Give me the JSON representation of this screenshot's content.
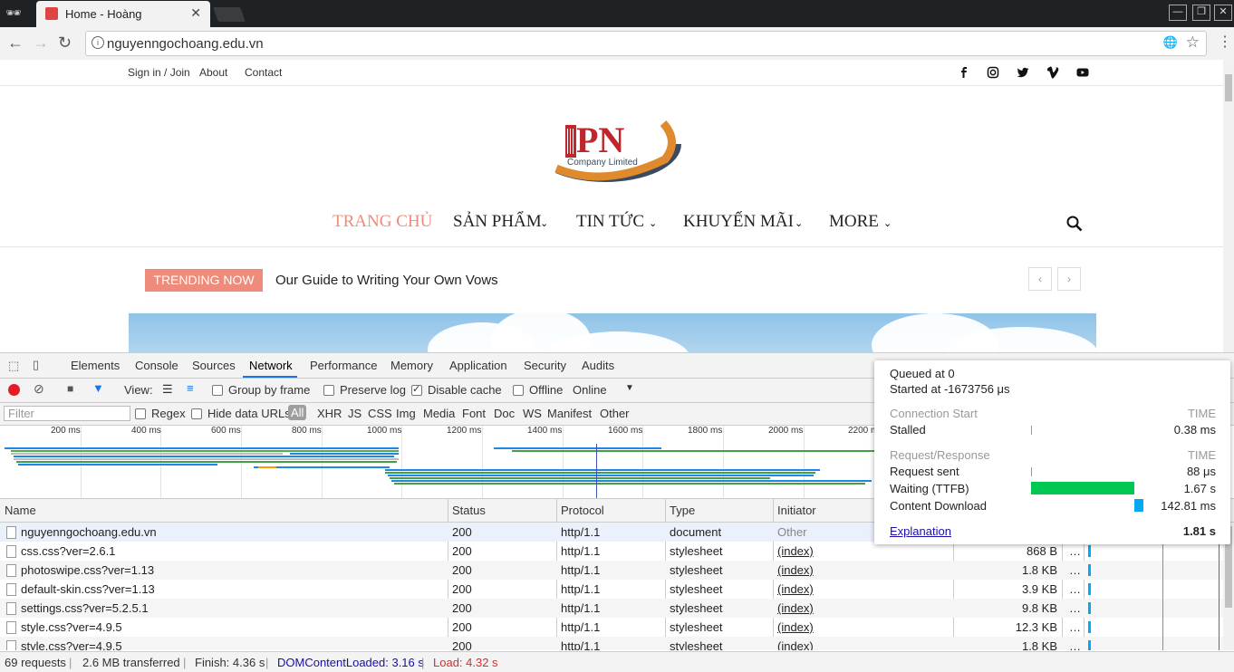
{
  "browser": {
    "tab_title": "Home - Hoàng",
    "url": "nguyenngochoang.edu.vn",
    "window_controls": [
      "—",
      "❐",
      "✕"
    ]
  },
  "site": {
    "topnav": [
      "Sign in / Join",
      "About",
      "Contact"
    ],
    "social_icons": [
      "facebook-icon",
      "instagram-icon",
      "twitter-icon",
      "vimeo-icon",
      "youtube-icon"
    ],
    "logo_letters": "PN",
    "logo_text": "Company Limited",
    "mainnav": [
      "TRANG CHỦ",
      "SẢN PHẨM",
      "TIN TỨC",
      "KHUYẾN MÃI",
      "MORE"
    ],
    "mainnav_active_color": "#ef8b7a",
    "trending_label": "TRENDING NOW",
    "trending_text": "Our Guide to Writing Your Own Vows",
    "prev_arrow": "‹",
    "next_arrow": "›"
  },
  "devtools": {
    "tabs": [
      "Elements",
      "Console",
      "Sources",
      "Network",
      "Performance",
      "Memory",
      "Application",
      "Security",
      "Audits"
    ],
    "active_tab": "Network",
    "bar2": {
      "view_label": "View:",
      "group_by_frame": "Group by frame",
      "preserve_log": "Preserve log",
      "disable_cache": "Disable cache",
      "offline": "Offline",
      "throttle": "Online"
    },
    "bar3": {
      "filter_placeholder": "Filter",
      "regex": "Regex",
      "hide_data_urls": "Hide data URLs",
      "all": "All",
      "types": [
        "XHR",
        "JS",
        "CSS",
        "Img",
        "Media",
        "Font",
        "Doc",
        "WS",
        "Manifest",
        "Other"
      ]
    },
    "timeline_ticks": [
      "200 ms",
      "400 ms",
      "600 ms",
      "800 ms",
      "1000 ms",
      "1200 ms",
      "1400 ms",
      "1600 ms",
      "1800 ms",
      "2000 ms",
      "2200 ms"
    ],
    "columns": [
      "Name",
      "Status",
      "Protocol",
      "Type",
      "Initiator"
    ],
    "rows": [
      {
        "name": "nguyenngochoang.edu.vn",
        "status": "200",
        "protocol": "http/1.1",
        "type": "document",
        "initiator": "Other",
        "size": "",
        "more": ""
      },
      {
        "name": "css.css?ver=2.6.1",
        "status": "200",
        "protocol": "http/1.1",
        "type": "stylesheet",
        "initiator": "(index)",
        "size": "868 B",
        "more": "…"
      },
      {
        "name": "photoswipe.css?ver=1.13",
        "status": "200",
        "protocol": "http/1.1",
        "type": "stylesheet",
        "initiator": "(index)",
        "size": "1.8 KB",
        "more": "…"
      },
      {
        "name": "default-skin.css?ver=1.13",
        "status": "200",
        "protocol": "http/1.1",
        "type": "stylesheet",
        "initiator": "(index)",
        "size": "3.9 KB",
        "more": "…"
      },
      {
        "name": "settings.css?ver=5.2.5.1",
        "status": "200",
        "protocol": "http/1.1",
        "type": "stylesheet",
        "initiator": "(index)",
        "size": "9.8 KB",
        "more": "…"
      },
      {
        "name": "style.css?ver=4.9.5",
        "status": "200",
        "protocol": "http/1.1",
        "type": "stylesheet",
        "initiator": "(index)",
        "size": "12.3 KB",
        "more": "…"
      },
      {
        "name": "style.css?ver=4.9.5",
        "status": "200",
        "protocol": "http/1.1",
        "type": "stylesheet",
        "initiator": "(index)",
        "size": "1.8 KB",
        "more": "…"
      }
    ],
    "status": {
      "requests": "69 requests",
      "transferred": "2.6 MB transferred",
      "finish": "Finish: 4.36 s",
      "domcontentloaded": "DOMContentLoaded: 3.16 s",
      "load": "Load: 4.32 s",
      "sep": "|"
    },
    "timing": {
      "queued": "Queued at 0",
      "started": "Started at -1673756 μs",
      "conn_header": "Connection Start",
      "time_label": "TIME",
      "stalled_label": "Stalled",
      "stalled_value": "0.38 ms",
      "req_header": "Request/Response",
      "request_sent_label": "Request sent",
      "request_sent_value": "88 μs",
      "waiting_label": "Waiting (TTFB)",
      "waiting_value": "1.67 s",
      "download_label": "Content Download",
      "download_value": "142.81 ms",
      "explanation": "Explanation",
      "total": "1.81 s",
      "waiting_color": "#00c853",
      "download_color": "#03a9f4"
    }
  }
}
